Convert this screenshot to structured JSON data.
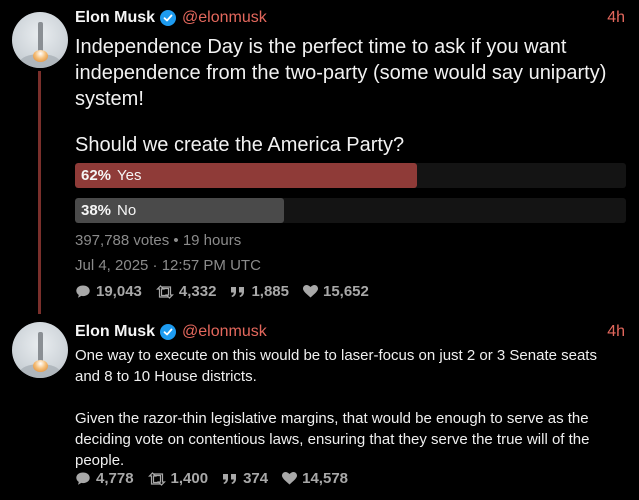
{
  "tweet1": {
    "name": "Elon Musk",
    "handle": "@elonmusk",
    "time": "4h",
    "text": "Independence Day is the perfect time to ask if you want independence from the two-party (some would say uniparty) system!",
    "poll": {
      "question": "Should we create the America Party?",
      "options": [
        {
          "pct": "62%",
          "label": "Yes",
          "fraction": 0.62,
          "color": "#8f3b38"
        },
        {
          "pct": "38%",
          "label": "No",
          "fraction": 0.38,
          "color": "#4a4a4a"
        }
      ],
      "summary": "397,788 votes • 19 hours"
    },
    "date": "Jul 4, 2025 · 12:57 PM UTC",
    "stats": {
      "replies": "19,043",
      "retweets": "4,332",
      "quotes": "1,885",
      "likes": "15,652"
    }
  },
  "tweet2": {
    "name": "Elon Musk",
    "handle": "@elonmusk",
    "time": "4h",
    "paragraph1": "One way to execute on this would be to laser-focus on just 2 or 3 Senate seats and 8 to 10 House districts.",
    "paragraph2": "Given the razor-thin legislative margins, that would be enough to serve as the deciding vote on contentious laws, ensuring that they serve the true will of the people.",
    "stats": {
      "replies": "4,778",
      "retweets": "1,400",
      "quotes": "374",
      "likes": "14,578"
    }
  },
  "colors": {
    "accent": "#e4685d",
    "verified": "#1d9bf0",
    "thread_line": "#7a2f2b"
  },
  "icons": [
    "verified-icon",
    "reply-icon",
    "retweet-icon",
    "quote-icon",
    "like-icon"
  ]
}
